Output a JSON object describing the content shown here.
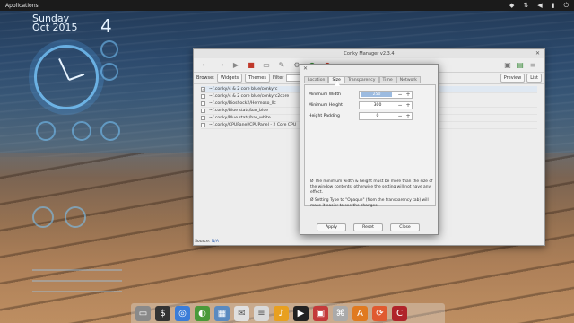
{
  "top_panel": {
    "applications_label": "Applications",
    "tray_icons": [
      "dropbox-icon",
      "network-icon",
      "volume-icon",
      "battery-icon",
      "power-icon"
    ]
  },
  "conky": {
    "day_name": "Sunday",
    "month_year": "Oct 2015",
    "day_number": "4"
  },
  "conky_manager": {
    "title": "Conky Manager v2.3.4",
    "filter_bar": {
      "browse_label": "Browse:",
      "widgets_label": "Widgets",
      "themes_label": "Themes",
      "filter_label": "Filter",
      "preview_label": "Preview",
      "list_label": "List"
    },
    "rows": [
      {
        "text": "~/.conky/4 & 2 core blue/conkyrc",
        "checked": true
      },
      {
        "text": "~/.conky/4 & 2 core blue/conkyrc2core",
        "checked": false
      },
      {
        "text": "~/.conky/Bioshock2/Hermoso_llc",
        "checked": false
      },
      {
        "text": "~/.conky/Blue stats/bar_blue",
        "checked": false
      },
      {
        "text": "~/.conky/Blue stats/bar_white",
        "checked": false
      },
      {
        "text": "~/.conky/CPUPanel/CPUPanel - 2 Core CPU",
        "checked": false
      }
    ],
    "source_label": "Source:",
    "source_link": "N/A"
  },
  "dialog": {
    "tabs": [
      "Location",
      "Size",
      "Transparency",
      "Time",
      "Network"
    ],
    "active_tab": "Size",
    "fields": [
      {
        "label": "Minimum Width",
        "value": "250",
        "highlighted": true
      },
      {
        "label": "Minimum Height",
        "value": "300",
        "highlighted": false
      },
      {
        "label": "Height Padding",
        "value": "0",
        "highlighted": false
      }
    ],
    "note1": "Ø The minimum width & height must be more than the size of the window contents, otherwise the setting will not have any effect.",
    "note2": "Ø Setting Type to \"Opaque\" (from the transparency tab) will make it easier to see the changes",
    "buttons": {
      "apply": "Apply",
      "reset": "Reset",
      "close": "Close"
    }
  },
  "dock": {
    "items": [
      "file-manager-icon",
      "terminal-icon",
      "browser-icon",
      "media-icon",
      "settings-icon",
      "mail-icon",
      "text-editor-icon",
      "music-icon",
      "video-icon",
      "photos-icon",
      "calculator-icon",
      "app-center-icon",
      "updates-icon",
      "conky-icon"
    ]
  },
  "colors": {
    "panel_bg": "#1b1b1b",
    "window_bg": "#ededed",
    "selection": "#9cbbe0",
    "conky_text": "#d8ecff"
  }
}
